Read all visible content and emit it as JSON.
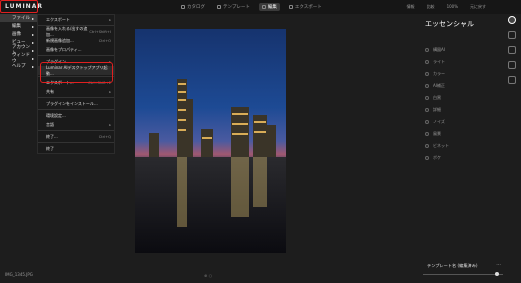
{
  "app": {
    "logo": "LUMINAR",
    "top_tabs": [
      {
        "label": "カタログ",
        "active": false
      },
      {
        "label": "テンプレート",
        "active": false
      },
      {
        "label": "編集",
        "active": true
      },
      {
        "label": "エクスポート",
        "active": false
      }
    ],
    "top_right": [
      "情報",
      "比較",
      "100%",
      "元に戻す"
    ]
  },
  "sidenav": {
    "items": [
      {
        "label": "ファイル",
        "active": true
      },
      {
        "label": "編集",
        "active": false
      },
      {
        "label": "画像",
        "active": false
      },
      {
        "label": "ビュー",
        "active": false
      },
      {
        "label": "アカウント",
        "active": false
      },
      {
        "label": "ウィンドウ",
        "active": false
      },
      {
        "label": "ヘルプ",
        "active": false
      }
    ]
  },
  "file_menu": {
    "items": [
      {
        "label": "エクスポート",
        "shortcut": "",
        "submenu": true,
        "selected": false
      },
      {
        "label": "画像を入れる/出すの追加...",
        "shortcut": "Ctrl+Shift+I",
        "submenu": false,
        "selected": false
      },
      {
        "label": "新規画像追加...",
        "shortcut": "Ctrl+O",
        "submenu": false,
        "selected": false
      },
      {
        "label": "画像をプロパティ...",
        "shortcut": "",
        "submenu": false,
        "selected": false
      },
      {
        "label": "プラグイン...",
        "shortcut": "",
        "submenu": true,
        "selected": false
      },
      {
        "label": "Luminar AIデスクトップアプリ起動...",
        "shortcut": "",
        "submenu": false,
        "selected": true
      },
      {
        "label": "エクスポート...",
        "shortcut": "Ctrl+Shift+E",
        "submenu": false,
        "selected": false
      },
      {
        "label": "共有",
        "shortcut": "",
        "submenu": true,
        "selected": false
      },
      {
        "label": "プラグインをインストール...",
        "shortcut": "",
        "submenu": false,
        "selected": false
      },
      {
        "label": "環境設定...",
        "shortcut": "",
        "submenu": false,
        "selected": false
      },
      {
        "label": "言語",
        "shortcut": "",
        "submenu": true,
        "selected": false
      },
      {
        "label": "終了...",
        "shortcut": "Ctrl+Q",
        "submenu": false,
        "selected": false
      },
      {
        "label": "終了",
        "shortcut": "",
        "submenu": false,
        "selected": false
      }
    ]
  },
  "right_panel": {
    "title": "エッセンシャル",
    "tools": [
      {
        "label": "構図AI",
        "icon": "composition-icon"
      },
      {
        "label": "ライト",
        "icon": "light-icon"
      },
      {
        "label": "カラー",
        "icon": "color-icon"
      },
      {
        "label": "AI補正",
        "icon": "enhance-icon"
      },
      {
        "label": "白黒",
        "icon": "bw-icon"
      },
      {
        "label": "詳細",
        "icon": "details-icon"
      },
      {
        "label": "ノイズ",
        "icon": "noise-icon"
      },
      {
        "label": "風景",
        "icon": "landscape-icon"
      },
      {
        "label": "ビネット",
        "icon": "vignette-icon"
      },
      {
        "label": "ボケ",
        "icon": "bokeh-icon"
      }
    ],
    "preset_label": "テンプレート名 (編集済み)",
    "preset_amount": 0.92
  },
  "status": {
    "filename": "IMG_1345.JPG"
  },
  "colors": {
    "highlight": "#e02020"
  }
}
